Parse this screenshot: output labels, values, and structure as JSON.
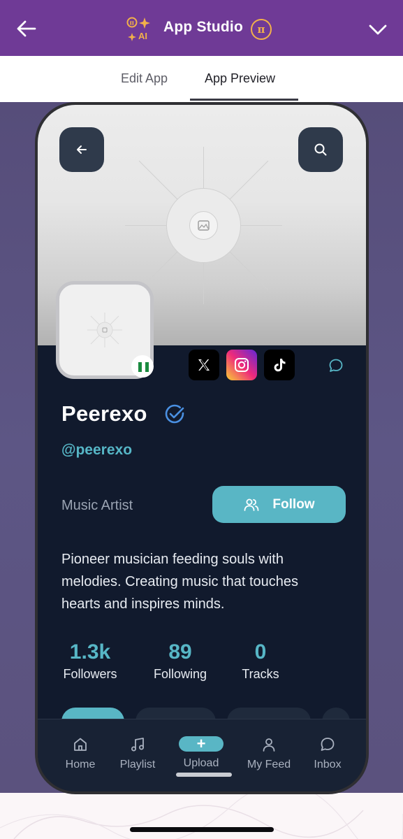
{
  "header": {
    "title": "App Studio",
    "ai_label": "AI",
    "pi_symbol": "π",
    "back_icon": "arrow-left-icon",
    "collapse_icon": "chevron-down-icon"
  },
  "tabs": [
    {
      "label": "Edit App",
      "active": false
    },
    {
      "label": "App Preview",
      "active": true
    }
  ],
  "profile": {
    "name": "Peerexo",
    "handle": "@peerexo",
    "verified": true,
    "category": "Music Artist",
    "follow_label": "Follow",
    "bio": "Pioneer musician feeding souls with melodies. Creating music that touches hearts and inspires minds.",
    "socials": [
      "x-icon",
      "instagram-icon",
      "tiktok-icon"
    ],
    "stats": [
      {
        "value": "1.3k",
        "label": "Followers"
      },
      {
        "value": "89",
        "label": "Following"
      },
      {
        "value": "0",
        "label": "Tracks"
      }
    ]
  },
  "nav": [
    {
      "label": "Home",
      "icon": "home-icon"
    },
    {
      "label": "Playlist",
      "icon": "music-note-icon"
    },
    {
      "label": "Upload",
      "icon": "plus-icon"
    },
    {
      "label": "My Feed",
      "icon": "user-icon"
    },
    {
      "label": "Inbox",
      "icon": "chat-icon"
    }
  ],
  "colors": {
    "header_bg": "#6f3a96",
    "accent_teal": "#59b6c5",
    "screen_bg": "#111a2d",
    "pi_gold": "#f2b14a"
  }
}
